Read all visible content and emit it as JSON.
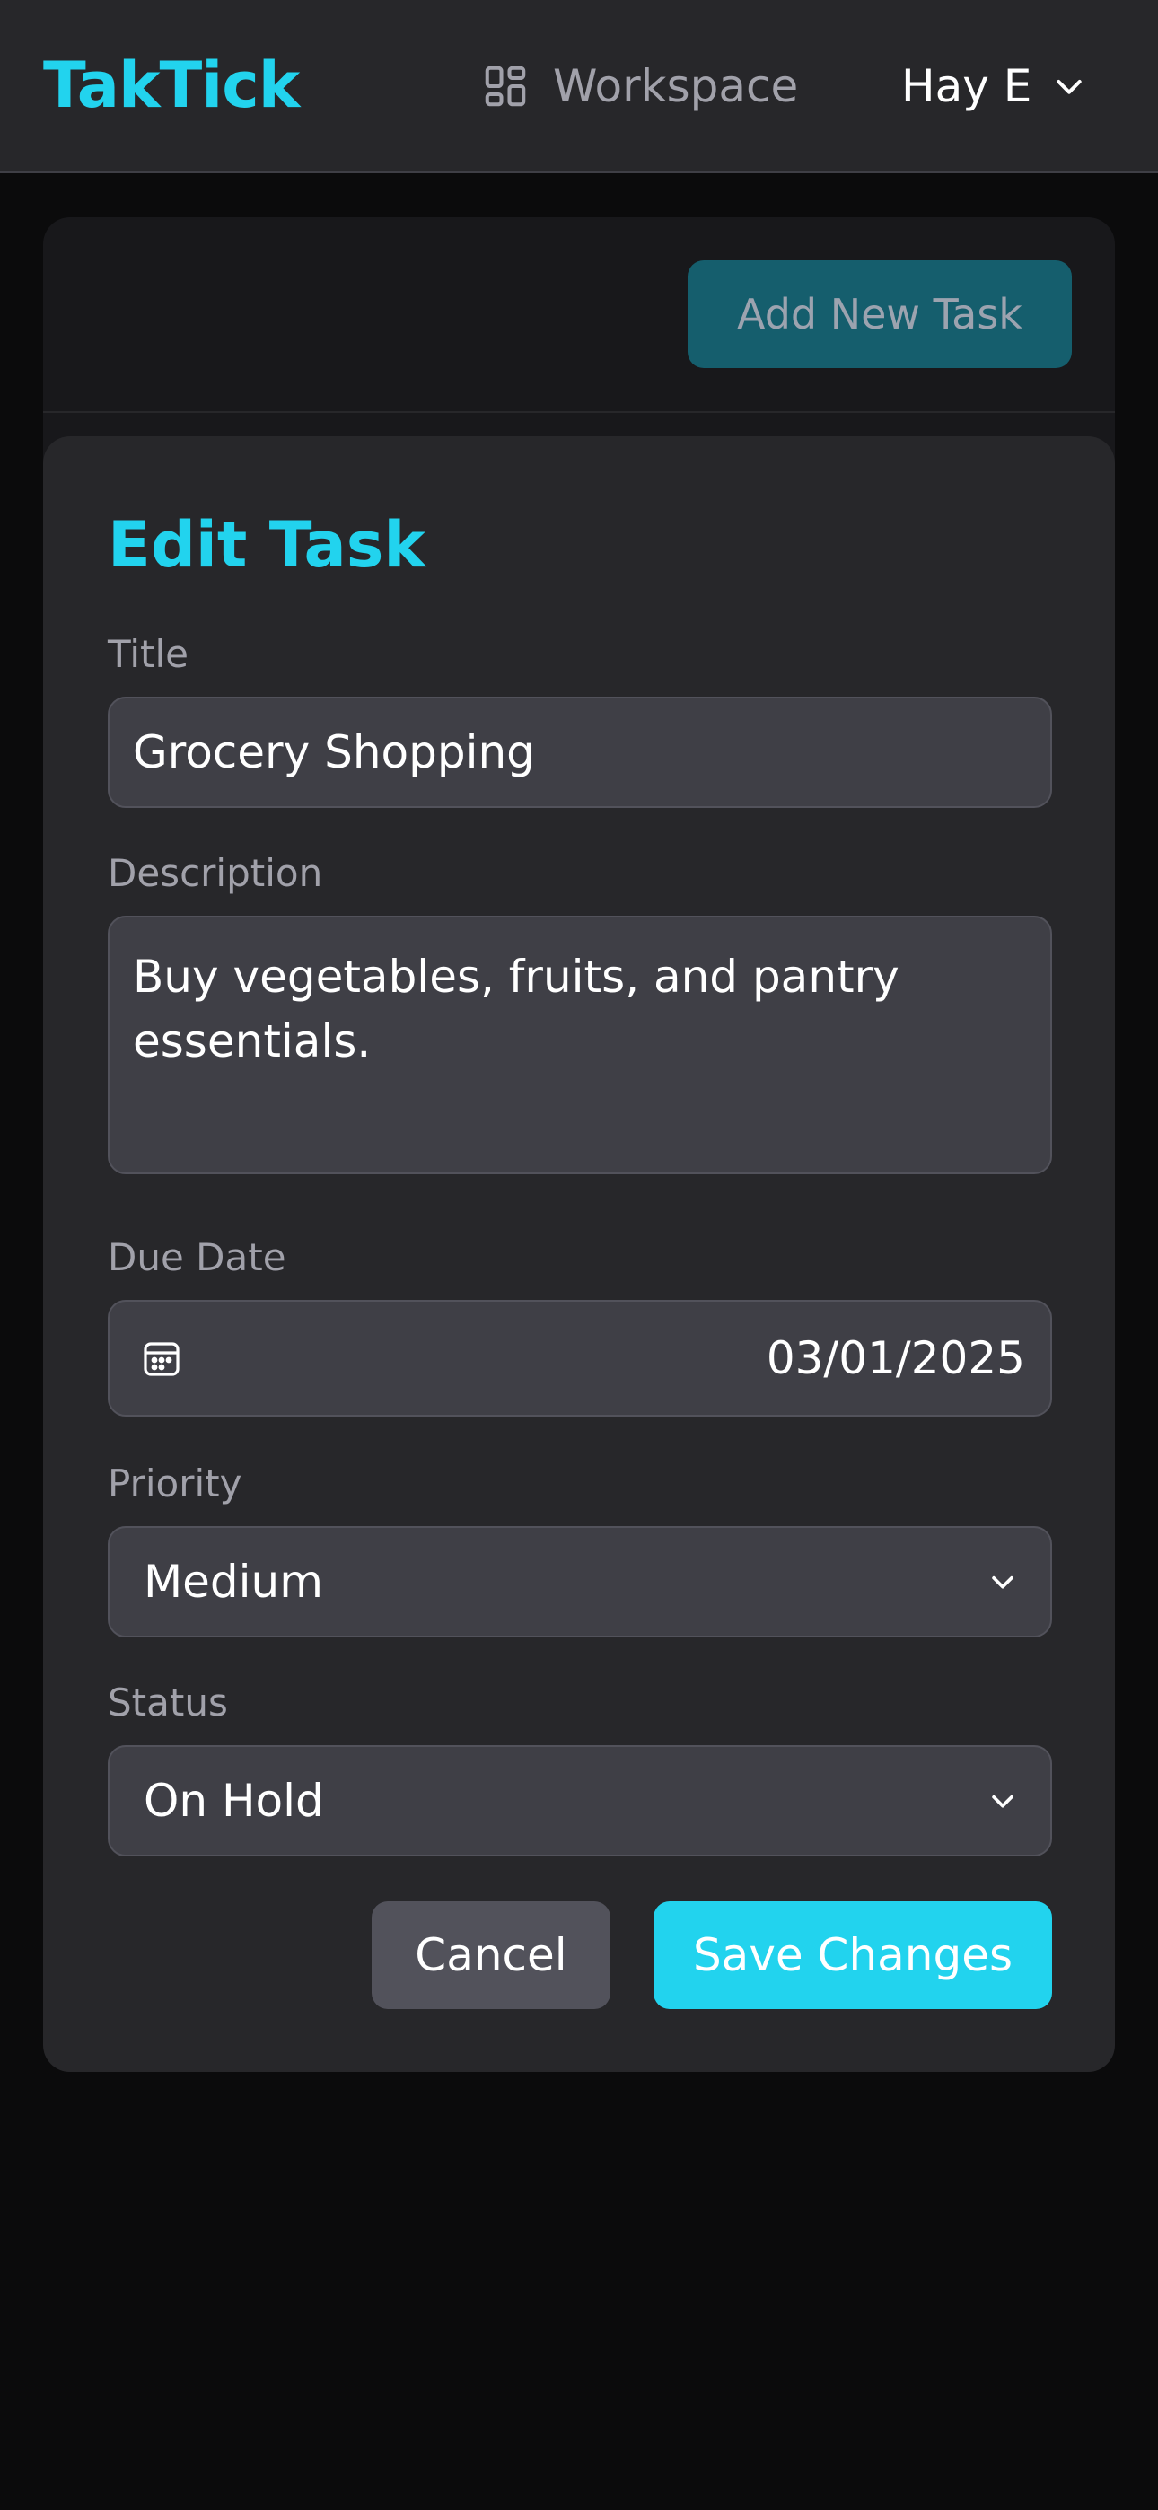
{
  "header": {
    "logo": "TakTick",
    "workspace_label": "Workspace",
    "user_name": "Hay E"
  },
  "toolbar": {
    "add_task_label": "Add New Task"
  },
  "modal": {
    "title": "Edit Task",
    "fields": {
      "title_label": "Title",
      "title_value": "Grocery Shopping",
      "description_label": "Description",
      "description_value": "Buy vegetables, fruits, and pantry essentials.",
      "due_date_label": "Due Date",
      "due_date_value": "03/01/2025",
      "priority_label": "Priority",
      "priority_value": "Medium",
      "status_label": "Status",
      "status_value": "On Hold"
    },
    "buttons": {
      "cancel": "Cancel",
      "save": "Save Changes"
    }
  },
  "icons": {
    "workspace": "grid-icon",
    "user_menu": "chevron-down-icon",
    "date": "calendar-icon",
    "select": "chevron-down-icon"
  },
  "colors": {
    "accent": "#22d3ee",
    "header_bg": "#27272a",
    "page_bg": "#0b0b0c",
    "field_bg": "#3f3f46",
    "cancel_bg": "#52525b",
    "add_task_bg": "#155e6d"
  }
}
